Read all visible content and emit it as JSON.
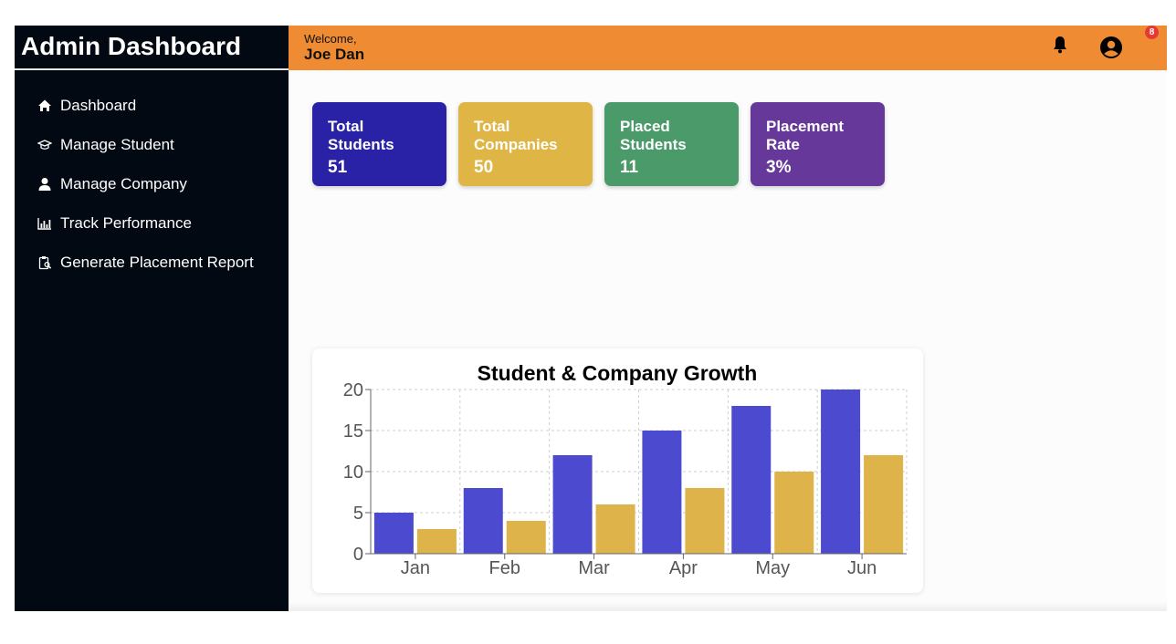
{
  "sidebar": {
    "title": "Admin Dashboard",
    "items": [
      {
        "label": "Dashboard",
        "icon": "home-icon"
      },
      {
        "label": "Manage Student",
        "icon": "graduation-cap-icon"
      },
      {
        "label": "Manage Company",
        "icon": "user-icon"
      },
      {
        "label": "Track Performance",
        "icon": "bar-chart-icon"
      },
      {
        "label": "Generate Placement Report",
        "icon": "clipboard-search-icon"
      }
    ]
  },
  "header": {
    "welcome": "Welcome,",
    "user_name": "Joe Dan",
    "notification_count": "8",
    "bar_color": "#ee8b33"
  },
  "stats": [
    {
      "title": "Total Students",
      "value": "51",
      "color": "#2a22a6"
    },
    {
      "title": "Total Companies",
      "value": "50",
      "color": "#dfb645"
    },
    {
      "title": "Placed Students",
      "value": "11",
      "color": "#4a9a6a"
    },
    {
      "title": "Placement Rate",
      "value": "3%",
      "color": "#663899"
    }
  ],
  "chart_data": {
    "type": "bar",
    "title": "Student & Company Growth",
    "categories": [
      "Jan",
      "Feb",
      "Mar",
      "Apr",
      "May",
      "Jun"
    ],
    "series": [
      {
        "values": [
          5,
          8,
          12,
          15,
          18,
          20
        ],
        "color": "#4c4bd0"
      },
      {
        "values": [
          3,
          4,
          6,
          8,
          10,
          12
        ],
        "color": "#ddb34a"
      }
    ],
    "yticks": [
      0,
      5,
      10,
      15,
      20
    ],
    "ylim": [
      0,
      20
    ],
    "grid": true
  }
}
